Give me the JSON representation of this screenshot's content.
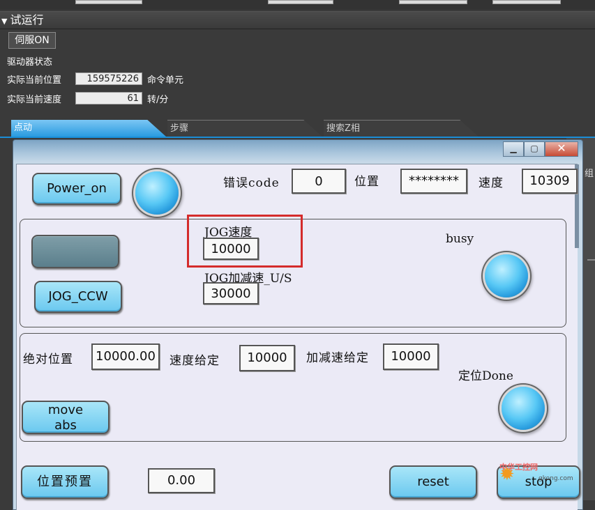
{
  "section": {
    "title": "试运行",
    "toggle_glyph": "▼"
  },
  "servo_button": "伺服ON",
  "drive_status": {
    "heading": "驱动器状态",
    "actual_position_label": "实际当前位置",
    "actual_position_value": "159575226",
    "actual_position_unit": "命令单元",
    "actual_speed_label": "实际当前速度",
    "actual_speed_value": "61",
    "actual_speed_unit": "转/分"
  },
  "tabs": [
    {
      "label": "点动",
      "active": true
    },
    {
      "label": "步骤",
      "active": false
    },
    {
      "label": "搜索Z相",
      "active": false
    }
  ],
  "right_fragment": "组",
  "window": {
    "controls": {
      "minimize": "▁",
      "maximize": "▢",
      "close": "✕"
    },
    "power_button": "Power_on",
    "error_code_label": "错误code",
    "error_code_value": "0",
    "position_label": "位置",
    "position_value": "********",
    "speed_label": "速度",
    "speed_value": "10309",
    "jog_speed_label": "JOG速度",
    "jog_speed_value": "10000",
    "jog_accel_label": "JOG加减速_U/S",
    "jog_accel_value": "30000",
    "jog_ccw_button": "JOG_CCW",
    "busy_label": "busy",
    "abs_position_label": "绝对位置",
    "abs_position_value": "10000.00",
    "speed_setting_label": "速度给定",
    "speed_setting_value": "10000",
    "accel_setting_label": "加减速给定",
    "accel_setting_value": "10000",
    "done_label": "定位Done",
    "move_abs_line1": "move",
    "move_abs_line2": "abs",
    "preset_button": "位置预置",
    "preset_value": "0.00",
    "reset_button": "reset",
    "stop_button": "stop"
  },
  "watermark": {
    "brand": "中华工控网",
    "site": "gkong.com"
  },
  "colors": {
    "highlight_box": "#d42b2b",
    "tab_active": "#2a9be0",
    "led": "#58c8f5"
  }
}
